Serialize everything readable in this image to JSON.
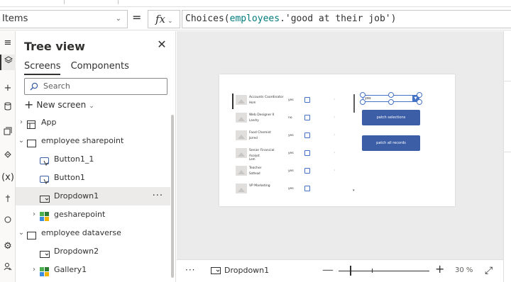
{
  "formula_bar": {
    "property": "Items",
    "equals": "=",
    "fx_label": "fx",
    "formula": {
      "fn": "Choices(",
      "id": "employees",
      "str": ".'good at their job')"
    }
  },
  "tree_view": {
    "title": "Tree view",
    "tabs": [
      "Screens",
      "Components"
    ],
    "search_placeholder": "Search",
    "new_screen_label": "New screen",
    "items": [
      {
        "label": "App"
      },
      {
        "label": "employee sharepoint"
      },
      {
        "label": "Button1_1"
      },
      {
        "label": "Button1"
      },
      {
        "label": "Dropdown1"
      },
      {
        "label": "gesharepoint"
      },
      {
        "label": "employee dataverse"
      },
      {
        "label": "Dropdown2"
      },
      {
        "label": "Gallery1"
      }
    ]
  },
  "canvas": {
    "gallery": [
      {
        "title": "Accounts Coordinator",
        "subtitle": "Hom",
        "value": "yes"
      },
      {
        "title": "Web Designer II",
        "subtitle": "Landry",
        "value": "no"
      },
      {
        "title": "Food Chemist",
        "subtitle": "Jarred",
        "value": "yes"
      },
      {
        "title": "Senior Financial",
        "subtitle": "Analyst\nLem",
        "value": "yes"
      },
      {
        "title": "Teacher",
        "subtitle": "Sattead",
        "value": "yes"
      },
      {
        "title": "VP Marketing",
        "subtitle": "",
        "value": "yes"
      }
    ],
    "dropdown_value": "yes",
    "button_patch_selections": "patch selections",
    "button_patch_all": "patch all records"
  },
  "status_bar": {
    "selected_control": "Dropdown1",
    "zoom_minus": "—",
    "zoom_plus": "+",
    "zoom_value": "30 %",
    "zoom_percent": 30
  },
  "colors": {
    "accent": "#3b5ea7",
    "selection": "#4472c4",
    "formula_identifier": "#007a7a"
  }
}
